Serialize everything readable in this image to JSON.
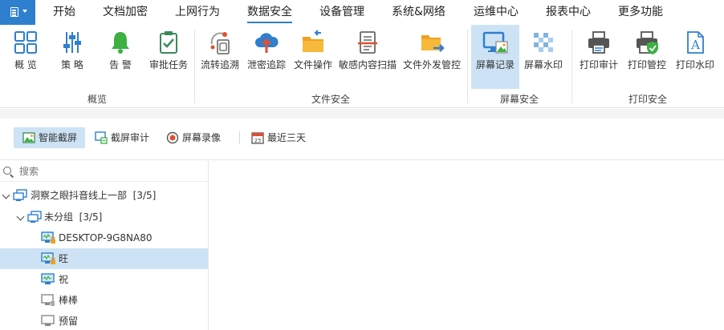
{
  "menu": {
    "items": [
      {
        "label": "开始",
        "active": false
      },
      {
        "label": "文档加密",
        "active": false
      },
      {
        "label": "上网行为",
        "active": false
      },
      {
        "label": "数据安全",
        "active": true
      },
      {
        "label": "设备管理",
        "active": false
      },
      {
        "label": "系统&网络",
        "active": false
      },
      {
        "label": "运维中心",
        "active": false
      },
      {
        "label": "报表中心",
        "active": false
      },
      {
        "label": "更多功能",
        "active": false
      }
    ]
  },
  "ribbon": {
    "groups": [
      {
        "label": "概览",
        "buttons": [
          {
            "label": "概 览",
            "icon": "grid-icon"
          },
          {
            "label": "策 略",
            "icon": "sliders-icon"
          },
          {
            "label": "告 警",
            "icon": "bell-icon"
          },
          {
            "label": "审批任务",
            "icon": "clipboard-check-icon"
          }
        ]
      },
      {
        "label": "文件安全",
        "buttons": [
          {
            "label": "流转追溯",
            "icon": "flow-trace-icon"
          },
          {
            "label": "泄密追踪",
            "icon": "cloud-upload-icon"
          },
          {
            "label": "文件操作",
            "icon": "folder-operation-icon"
          },
          {
            "label": "敏感内容扫描",
            "icon": "document-scan-icon"
          },
          {
            "label": "文件外发管控",
            "icon": "folder-send-icon"
          }
        ]
      },
      {
        "label": "屏幕安全",
        "buttons": [
          {
            "label": "屏幕记录",
            "icon": "monitor-image-icon",
            "selected": true
          },
          {
            "label": "屏幕水印",
            "icon": "watermark-icon"
          }
        ]
      },
      {
        "label": "打印安全",
        "buttons": [
          {
            "label": "打印审计",
            "icon": "printer-icon"
          },
          {
            "label": "打印管控",
            "icon": "printer-shield-icon"
          },
          {
            "label": "打印水印",
            "icon": "font-watermark-icon"
          }
        ]
      }
    ]
  },
  "toolbar": {
    "smart_screenshot": "智能截屏",
    "screenshot_audit": "截屏审计",
    "screen_recording": "屏幕录像",
    "date_range": "最近三天"
  },
  "tree": {
    "search_placeholder": "搜索",
    "root": {
      "label": "洞察之眼抖音线上一部",
      "count": "[3/5]"
    },
    "group": {
      "label": "未分组",
      "count": "[3/5]"
    },
    "devices": [
      {
        "label": "DESKTOP-9G8NA80",
        "status": "online-locked"
      },
      {
        "label": "旺",
        "status": "online-locked",
        "selected": true
      },
      {
        "label": "祝",
        "status": "online"
      },
      {
        "label": "棒棒",
        "status": "offline"
      },
      {
        "label": "预留",
        "status": "offline"
      }
    ]
  },
  "colors": {
    "accent": "#2f7fcf",
    "selected_bg": "#cde3f5",
    "green": "#3cb043",
    "orange": "#f0a020",
    "red": "#e05030"
  }
}
